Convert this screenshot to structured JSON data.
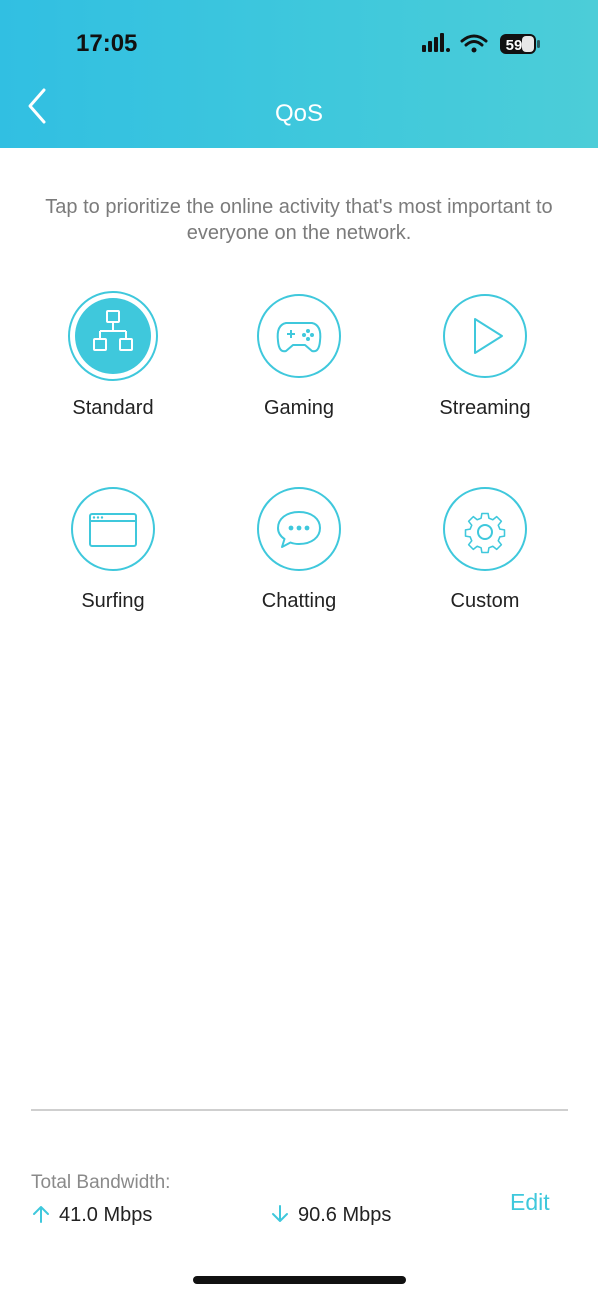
{
  "status_bar": {
    "time": "17:05",
    "battery": "59",
    "icons": [
      "signal-icon",
      "wifi-icon",
      "battery-icon"
    ]
  },
  "header": {
    "title": "QoS",
    "back_icon": "chevron-left-icon"
  },
  "intro": "Tap to prioritize the online activity that's most important to everyone on the network.",
  "modes": [
    {
      "label": "Standard",
      "icon": "network-topology-icon",
      "selected": true
    },
    {
      "label": "Gaming",
      "icon": "gamepad-icon",
      "selected": false
    },
    {
      "label": "Streaming",
      "icon": "play-icon",
      "selected": false
    },
    {
      "label": "Surfing",
      "icon": "browser-window-icon",
      "selected": false
    },
    {
      "label": "Chatting",
      "icon": "chat-bubble-icon",
      "selected": false
    },
    {
      "label": "Custom",
      "icon": "gear-icon",
      "selected": false
    }
  ],
  "bandwidth": {
    "title": "Total Bandwidth:",
    "upload": "41.0 Mbps",
    "download": "90.6 Mbps",
    "edit_label": "Edit"
  },
  "colors": {
    "accent": "#3fc8dc",
    "header_start": "#31bfe2",
    "header_end": "#4ccdd8"
  }
}
